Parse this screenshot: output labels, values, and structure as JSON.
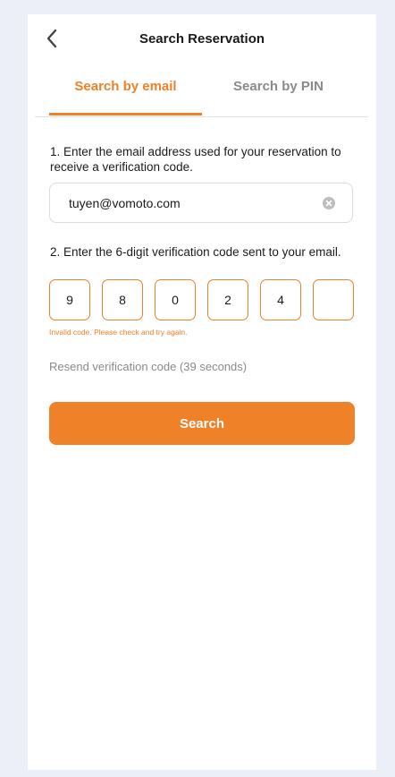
{
  "header": {
    "title": "Search Reservation"
  },
  "tabs": [
    {
      "label": "Search by email",
      "active": true
    },
    {
      "label": "Search by PIN",
      "active": false
    }
  ],
  "steps": {
    "step1": "1. Enter the email address used for your reservation to receive a verification code.",
    "step2": "2. Enter the 6-digit verification code sent to your email."
  },
  "email": {
    "value": "tuyen@vomoto.com"
  },
  "code": {
    "digits": [
      "9",
      "8",
      "0",
      "2",
      "4",
      ""
    ],
    "error": "Invalid code. Please check and try again."
  },
  "resend": {
    "label": "Resend verification code (39 seconds)"
  },
  "actions": {
    "search_label": "Search"
  },
  "colors": {
    "accent": "#ef8129",
    "background": "#eceff7",
    "muted_text": "#8a8a8a"
  },
  "icons": {
    "back": "chevron-left-icon",
    "clear": "clear-circle-icon"
  }
}
